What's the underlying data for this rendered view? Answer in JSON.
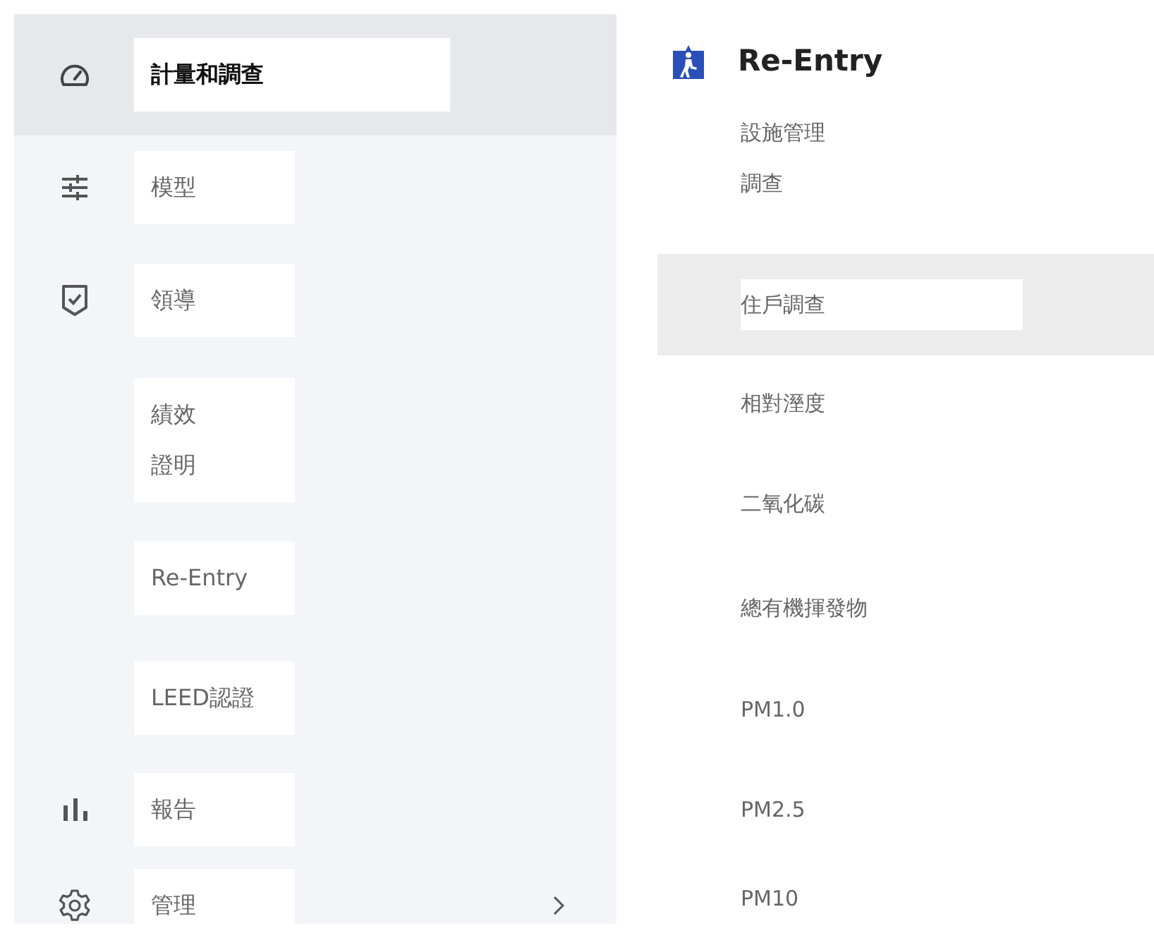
{
  "sidebar": {
    "items": [
      {
        "label": "計量和調查",
        "selected": true,
        "has_submenu": false
      },
      {
        "label": "模型",
        "selected": false,
        "has_submenu": false
      },
      {
        "label": "領導",
        "selected": false,
        "has_submenu": false
      },
      {
        "label_lines": [
          "績效",
          "證明"
        ],
        "selected": false,
        "has_submenu": false
      },
      {
        "label": "Re-Entry",
        "selected": false,
        "has_submenu": false
      },
      {
        "label": "LEED認證",
        "selected": false,
        "has_submenu": false
      },
      {
        "label": "報告",
        "selected": false,
        "has_submenu": false
      },
      {
        "label": "管理",
        "selected": false,
        "has_submenu": true
      }
    ]
  },
  "submenu": {
    "title": "Re-Entry",
    "items": [
      {
        "label_lines": [
          "設施管理",
          "調查"
        ],
        "selected": false
      },
      {
        "label": "住戶調查",
        "selected": true
      },
      {
        "label": "相對溼度",
        "selected": false
      },
      {
        "label": "二氧化碳",
        "selected": false
      },
      {
        "label": "總有機揮發物",
        "selected": false
      },
      {
        "label": "PM1.0",
        "selected": false
      },
      {
        "label": "PM2.5",
        "selected": false
      },
      {
        "label": "PM10",
        "selected": false
      }
    ]
  }
}
